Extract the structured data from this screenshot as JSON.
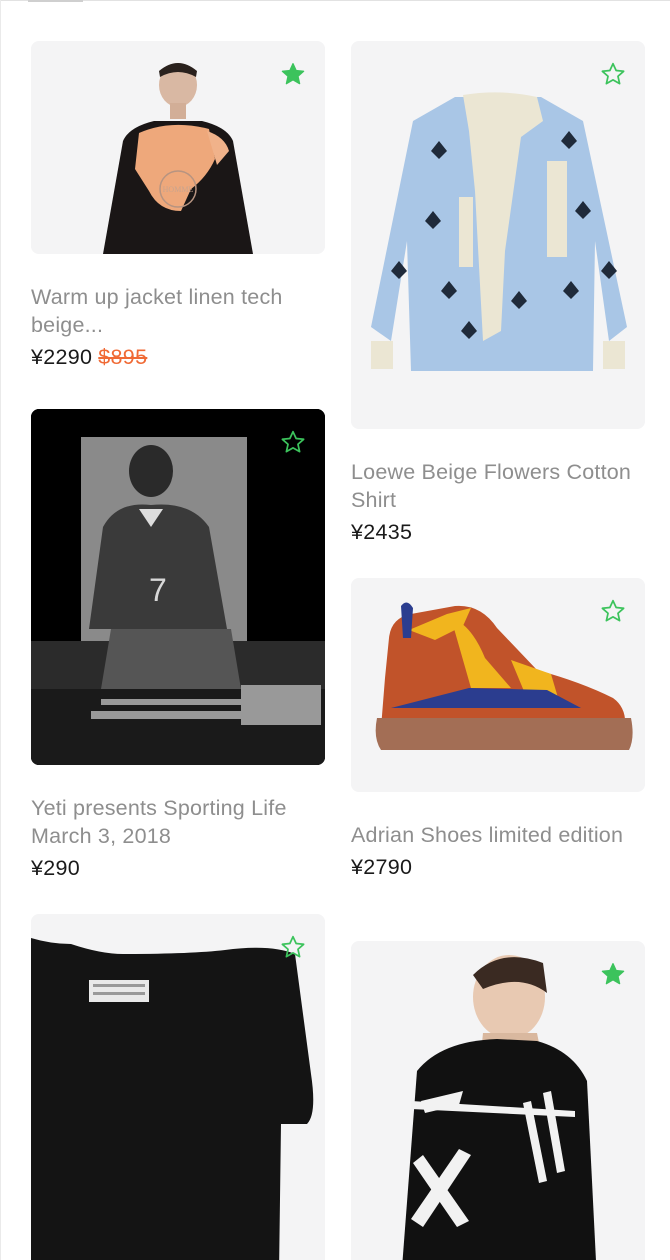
{
  "colors": {
    "star_active": "#3cc35c",
    "star_outline": "#3cc35c",
    "title_text": "#8e8e8e",
    "price_text": "#1a1a1a",
    "old_price": "#f06a35",
    "card_bg": "#f4f4f5"
  },
  "products": [
    {
      "title": "Warm up jacket linen tech beige...",
      "price": "¥2290",
      "old_price": "$895",
      "favorited": true,
      "image": "man-bleached-sweatshirt"
    },
    {
      "title": "Loewe Beige Flowers Cotton Shirt",
      "price": "¥2435",
      "old_price": "",
      "favorited": false,
      "image": "blue-floral-shirt"
    },
    {
      "title": "Yeti presents Sporting Life March 3, 2018",
      "price": "¥290",
      "old_price": "",
      "favorited": false,
      "image": "dj-bw-photo"
    },
    {
      "title": "Adrian Shoes limited edition",
      "price": "¥2790",
      "old_price": "",
      "favorited": false,
      "image": "color-block-boot"
    },
    {
      "title": "",
      "price": "",
      "old_price": "",
      "favorited": false,
      "image": "black-tshirt"
    },
    {
      "title": "",
      "price": "",
      "old_price": "",
      "favorited": true,
      "image": "man-black-arrows-jacket"
    }
  ]
}
